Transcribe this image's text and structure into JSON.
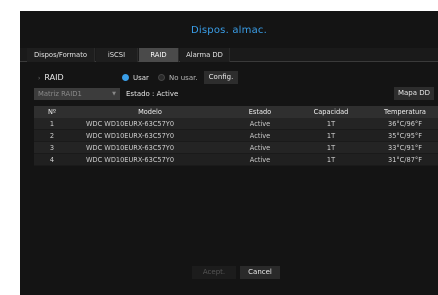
{
  "window": {
    "title": "Dispos. almac."
  },
  "tabs": [
    {
      "label": "Dispos/Formato",
      "active": false
    },
    {
      "label": "iSCSI",
      "active": false
    },
    {
      "label": "RAID",
      "active": true
    },
    {
      "label": "Alarma DD",
      "active": false
    }
  ],
  "raid": {
    "label": "RAID",
    "use_label": "Usar",
    "no_use_label": "No usar.",
    "selected": "Usar",
    "config_label": "Config.",
    "matrix_select": "Matriz RAID1",
    "status_text": "Estado : Active",
    "map_button": "Mapa DD"
  },
  "table": {
    "headers": [
      "Nº",
      "Modelo",
      "Estado",
      "Capacidad",
      "Temperatura"
    ],
    "rows": [
      [
        "1",
        "WDC WD10EURX-63C57Y0",
        "Active",
        "1T",
        "36°C/96°F"
      ],
      [
        "2",
        "WDC WD10EURX-63C57Y0",
        "Active",
        "1T",
        "35°C/95°F"
      ],
      [
        "3",
        "WDC WD10EURX-63C57Y0",
        "Active",
        "1T",
        "33°C/91°F"
      ],
      [
        "4",
        "WDC WD10EURX-63C57Y0",
        "Active",
        "1T",
        "31°C/87°F"
      ]
    ]
  },
  "footer": {
    "accept_label": "Acept.",
    "cancel_label": "Cancel"
  },
  "colors": {
    "accent": "#3a9ee8",
    "background": "#141414"
  }
}
